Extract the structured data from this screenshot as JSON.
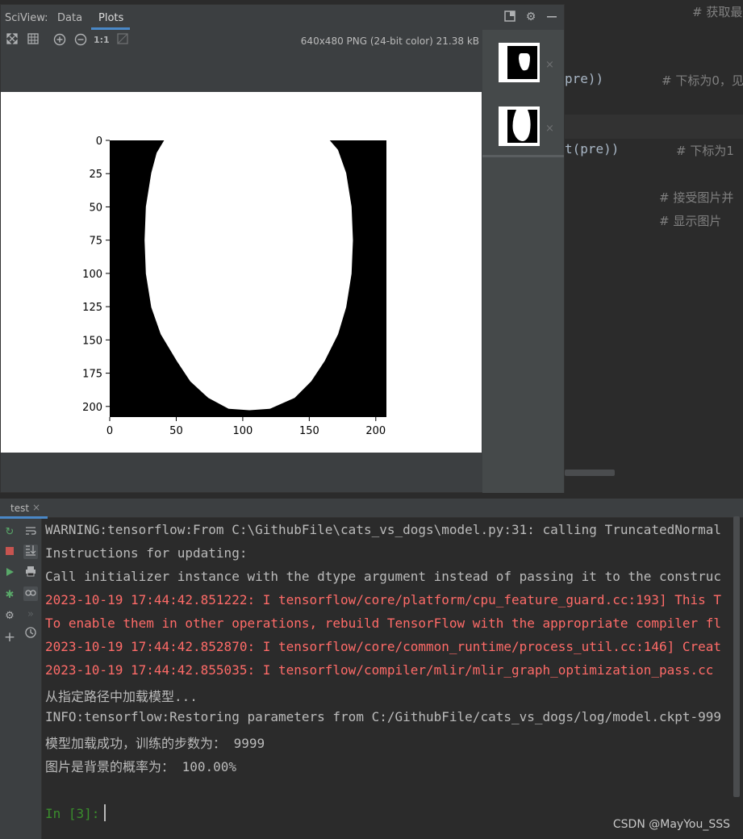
{
  "editor": {
    "code": [
      {
        "text": "pre))"
      },
      {
        "text": "t(pre))"
      }
    ],
    "comments": [
      {
        "text": "# 获取最"
      },
      {
        "text": "# 下标为0，见"
      },
      {
        "text": "# 下标为1"
      },
      {
        "text": "# 接受图片并"
      },
      {
        "text": "# 显示图片"
      }
    ]
  },
  "sciview": {
    "title": "SciView:",
    "tabs": [
      "Data",
      "Plots"
    ],
    "active_tab": "Plots",
    "toolbar": {
      "zoom_actual_label": "1:1",
      "image_info": "640x480 PNG (24-bit color) 21.38 kB"
    },
    "thumbnails": [
      {
        "label": "thumbnail-1",
        "close": "×"
      },
      {
        "label": "thumbnail-2",
        "close": "×"
      }
    ]
  },
  "chart_data": {
    "type": "image",
    "title": "",
    "xlabel": "",
    "ylabel": "",
    "x_ticks": [
      0,
      50,
      100,
      150,
      200
    ],
    "y_ticks": [
      0,
      25,
      50,
      75,
      100,
      125,
      150,
      175,
      200
    ],
    "xlim": [
      0,
      208
    ],
    "ylim": [
      208,
      0
    ],
    "description_colors": {
      "background": "#000000",
      "shape": "#ffffff"
    }
  },
  "run_window": {
    "tab_label": "test",
    "tab_close": "×",
    "console_lines": [
      {
        "text": "WARNING:tensorflow:From C:\\GithubFile\\cats_vs_dogs\\model.py:31: calling TruncatedNormal",
        "style": "normal"
      },
      {
        "text": "Instructions for updating:",
        "style": "normal"
      },
      {
        "text": "Call initializer instance with the dtype argument instead of passing it to the construc",
        "style": "normal"
      },
      {
        "text": "2023-10-19 17:44:42.851222: I tensorflow/core/platform/cpu_feature_guard.cc:193] This T",
        "style": "red"
      },
      {
        "text": "To enable them in other operations, rebuild TensorFlow with the appropriate compiler fl",
        "style": "red"
      },
      {
        "text": "2023-10-19 17:44:42.852870: I tensorflow/core/common_runtime/process_util.cc:146] Creat",
        "style": "red"
      },
      {
        "text": "2023-10-19 17:44:42.855035: I tensorflow/compiler/mlir/mlir_graph_optimization_pass.cc",
        "style": "red"
      },
      {
        "text": "从指定路径中加载模型...",
        "style": "normal"
      },
      {
        "text": "INFO:tensorflow:Restoring parameters from C:/GithubFile/cats_vs_dogs/log/model.ckpt-999",
        "style": "normal"
      },
      {
        "text": "模型加载成功，训练的步数为： 9999",
        "style": "normal"
      },
      {
        "text": "图片是背景的概率为： 100.00%",
        "style": "normal"
      }
    ],
    "prompt": "In [3]:"
  },
  "watermark": "CSDN @MayYou_SSS",
  "colors": {
    "bg": "#2b2b2b",
    "panel": "#3c3f41",
    "error_text": "#ff6b68",
    "prompt_green": "#3a8e2c",
    "accent": "#4a88c7"
  }
}
